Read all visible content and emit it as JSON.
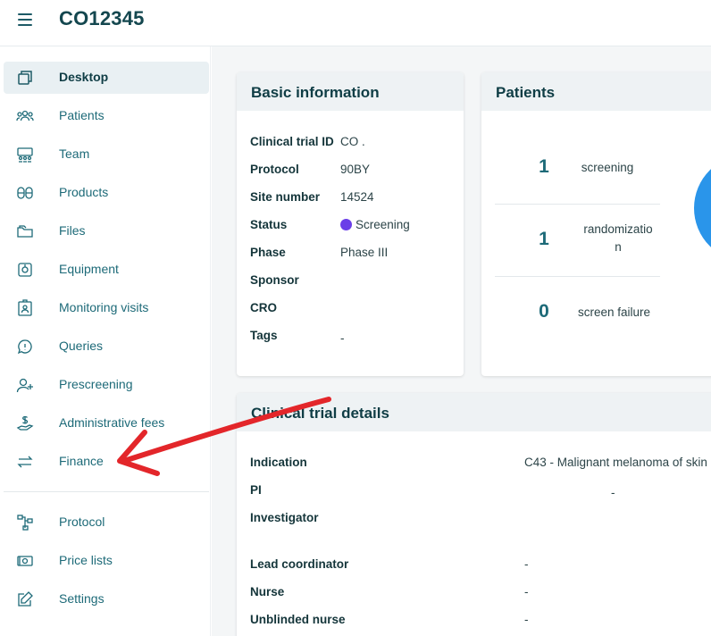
{
  "header": {
    "title": "CO12345"
  },
  "sidebar": {
    "items": [
      {
        "label": "Desktop",
        "icon": "desktop-icon",
        "active": true
      },
      {
        "label": "Patients",
        "icon": "patients-icon"
      },
      {
        "label": "Team",
        "icon": "team-icon"
      },
      {
        "label": "Products",
        "icon": "products-icon"
      },
      {
        "label": "Files",
        "icon": "files-icon"
      },
      {
        "label": "Equipment",
        "icon": "equipment-icon"
      },
      {
        "label": "Monitoring visits",
        "icon": "monitoring-icon"
      },
      {
        "label": "Queries",
        "icon": "queries-icon"
      },
      {
        "label": "Prescreening",
        "icon": "prescreening-icon"
      },
      {
        "label": "Administrative fees",
        "icon": "admin-fees-icon"
      },
      {
        "label": "Finance",
        "icon": "finance-icon"
      }
    ],
    "secondary_items": [
      {
        "label": "Protocol",
        "icon": "protocol-icon"
      },
      {
        "label": "Price lists",
        "icon": "price-lists-icon"
      },
      {
        "label": "Settings",
        "icon": "settings-icon"
      }
    ]
  },
  "basic_info": {
    "title": "Basic information",
    "rows": [
      {
        "label": "Clinical trial ID",
        "value": "CO  ."
      },
      {
        "label": "Protocol",
        "value": "90BY"
      },
      {
        "label": "Site number",
        "value": "14524"
      },
      {
        "label": "Status",
        "value": "Screening"
      },
      {
        "label": "Phase",
        "value": "Phase III"
      },
      {
        "label": "Sponsor",
        "value": ""
      },
      {
        "label": "CRO",
        "value": ""
      },
      {
        "label": "Tags",
        "value": "-"
      }
    ]
  },
  "patients": {
    "title": "Patients",
    "stats": [
      {
        "count": "1",
        "label": "screening"
      },
      {
        "count": "1",
        "label": "randomizatio\nn"
      },
      {
        "count": "0",
        "label": "screen failure"
      }
    ]
  },
  "trial_details": {
    "title": "Clinical trial details",
    "rows": [
      {
        "label": "Indication",
        "value": "C43 - Malignant melanoma of skin"
      },
      {
        "label": "PI",
        "value": "-"
      },
      {
        "label": "Investigator",
        "value": ""
      },
      {
        "label": "Lead coordinator",
        "value": "-"
      },
      {
        "label": "Nurse",
        "value": "-"
      },
      {
        "label": "Unblinded nurse",
        "value": "-"
      }
    ]
  },
  "colors": {
    "accent": "#1d6a78",
    "status_screening": "#6a3ee8",
    "donut": "#2a95ea",
    "annotation_arrow": "#e3262a"
  }
}
